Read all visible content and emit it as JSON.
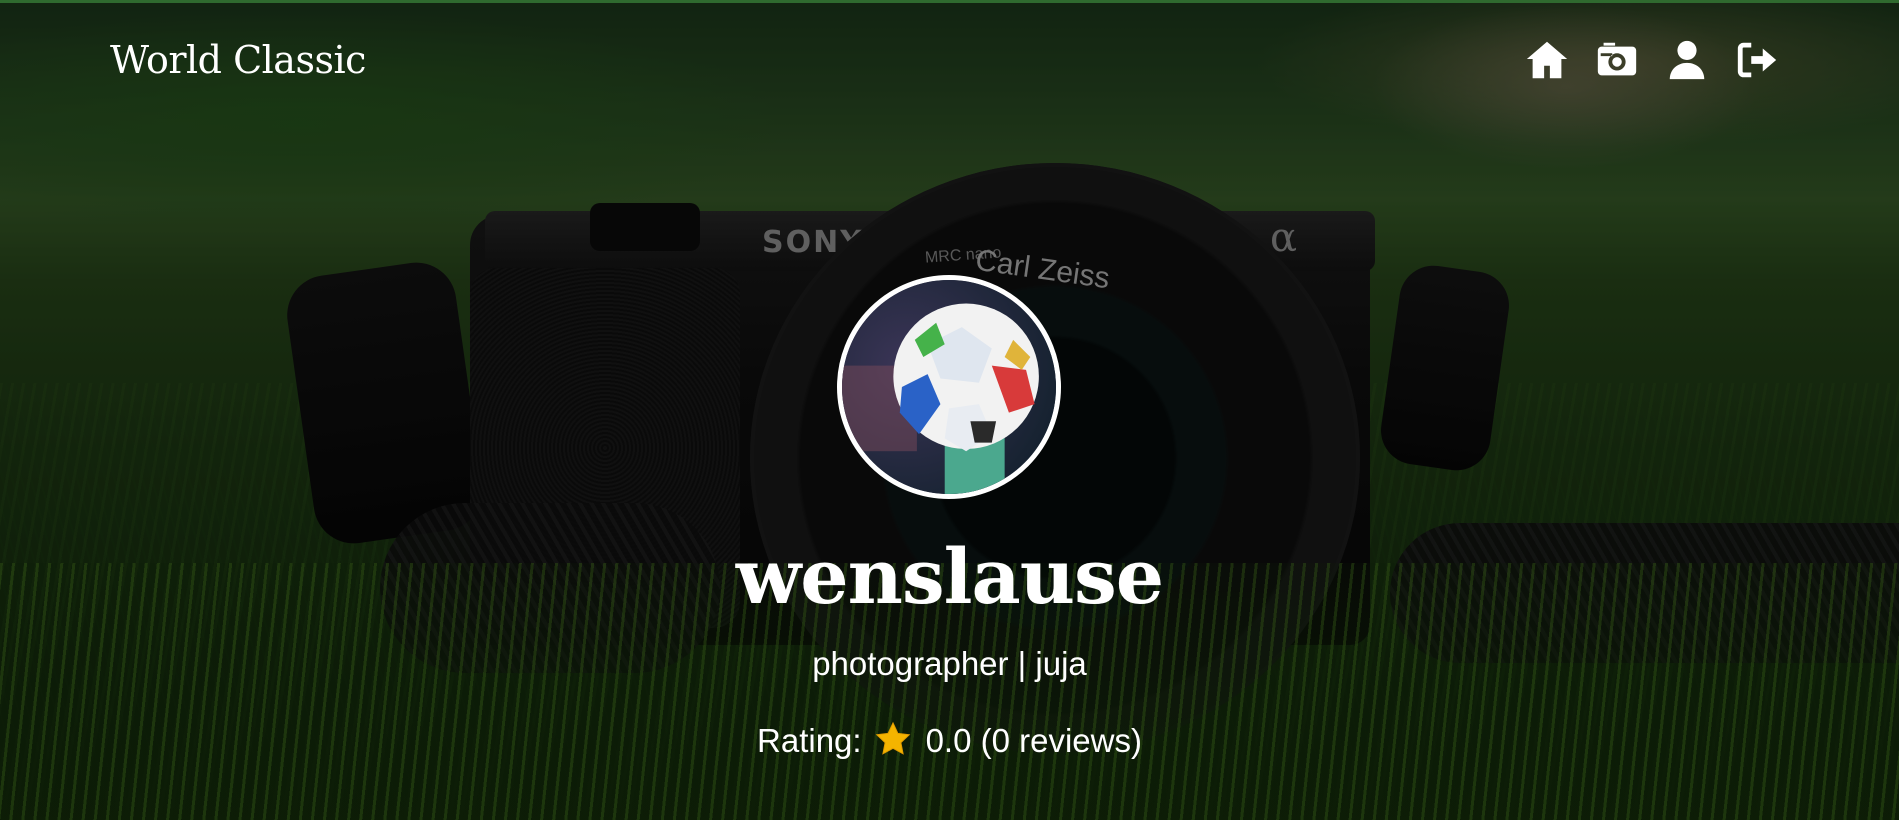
{
  "brand": {
    "name": "World Classic"
  },
  "nav": {
    "items": [
      {
        "name": "home-icon",
        "label": "Home"
      },
      {
        "name": "camera-icon",
        "label": "Photos"
      },
      {
        "name": "user-icon",
        "label": "Profile"
      },
      {
        "name": "logout-icon",
        "label": "Logout"
      }
    ]
  },
  "profile": {
    "username": "wenslause",
    "subtitle": "photographer | juja",
    "rating_label": "Rating:",
    "rating_value": "0.0 (0 reviews)",
    "rating_icon": "star-icon",
    "avatar_icon": "soccer-ball-avatar"
  },
  "colors": {
    "text": "#ffffff",
    "star": "#f4b400",
    "top_border": "#2f6a2f"
  }
}
